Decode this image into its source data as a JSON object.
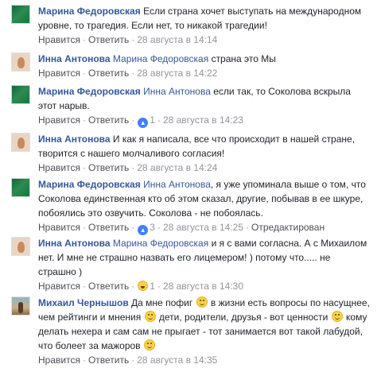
{
  "actions": {
    "like": "Нравится",
    "reply": "Ответить",
    "sep": "·",
    "edited": "Отредактирован"
  },
  "comments": [
    {
      "author": "Марина Федоровская",
      "avatar_icon": "green-avatar",
      "text": "Если страна хочет выступать на международном уровне, то трагедия. Если нет, то никакой трагедии!",
      "likes": "",
      "time": "28 августа в 14:14"
    },
    {
      "author": "Инна Антонова",
      "avatar_icon": "portrait-avatar",
      "mention": "Марина Федоровская",
      "text": "страна это Мы",
      "likes": "",
      "time": "28 августа в 14:22"
    },
    {
      "author": "Марина Федоровская",
      "avatar_icon": "green-avatar",
      "mention": "Инна Антонова",
      "text": "если так, то Соколова вскрыла этот нарыв.",
      "likes": "1",
      "time": "28 августа в 14:23"
    },
    {
      "author": "Инна Антонова",
      "avatar_icon": "portrait-avatar",
      "text": "И как я написала, все что происходит в нашей стране, творится с нашего молчаливого согласия!",
      "likes": "",
      "time": "28 августа в 14:24"
    },
    {
      "author": "Марина Федоровская",
      "avatar_icon": "green-avatar",
      "mention": "Инна Антонова",
      "text": ", я уже упоминала выше о том, что Соколова единственная кто об этом сказал, другие, побывав в ее шкуре, побоялись это озвучить. Соколова - не побоялась.",
      "likes": "3",
      "time": "28 августа в 14:25",
      "edited": true
    },
    {
      "author": "Инна Антонова",
      "avatar_icon": "portrait-avatar",
      "mention": "Марина Федоровская",
      "text": "и я с вами согласна. А с Михаилом нет. И мне не страшно назвать его лицемером! ) потому что..... не страшно )",
      "likes": "1",
      "time": "28 августа в 14:30"
    },
    {
      "author": "Михаил Чернышов",
      "avatar_icon": "beach-avatar",
      "text_parts": [
        "Да мне пофиг",
        "в жизни есть вопросы по насущнее, чем рейтинги и мнения",
        "дети, родители, друзья - вот ценности",
        "кому делать нехера и сам сам не прыгает - тот занимается вот такой лабудой, что болеет за мажоров"
      ],
      "likes": "",
      "time": "28 августа в 14:35"
    }
  ]
}
